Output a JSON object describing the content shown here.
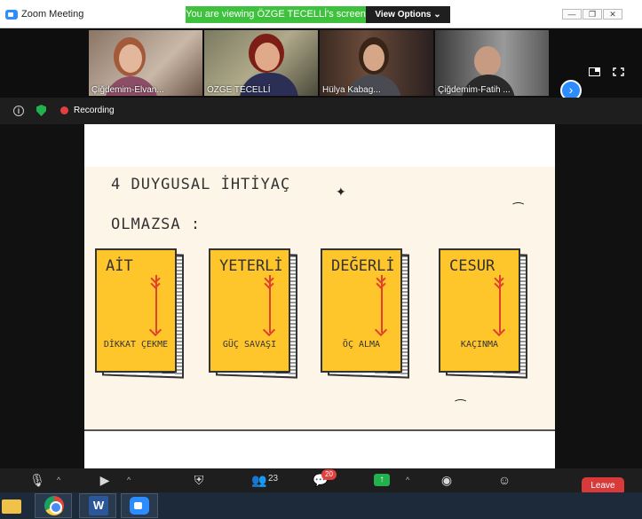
{
  "window": {
    "title": "Zoom Meeting"
  },
  "share_banner": {
    "text": "You are viewing ÖZGE TECELLİ's screen",
    "view_options": "View Options ⌄"
  },
  "window_controls": {
    "minimize": "—",
    "restore": "❐",
    "close": "✕"
  },
  "participants": [
    {
      "name": "Çiğdemim-Elvan..."
    },
    {
      "name": "ÖZGE TECELLİ"
    },
    {
      "name": "Hülya Kabag..."
    },
    {
      "name": "Çiğdemim-Fatih ..."
    }
  ],
  "status": {
    "recording": "Recording"
  },
  "slide": {
    "title_line1": "4 DUYGUSAL İHTİYAÇ",
    "title_line2": "OLMAZSA :",
    "cards": [
      {
        "need": "AİT",
        "result": "DİKKAT ÇEKME"
      },
      {
        "need": "YETERLİ",
        "result": "GÜÇ SAVAŞI"
      },
      {
        "need": "DEĞERLİ",
        "result": "ÖÇ ALMA"
      },
      {
        "need": "CESUR",
        "result": "KAÇINMA"
      }
    ]
  },
  "toolbar": {
    "participants_count": "23",
    "chat_badge": "20",
    "leave": "Leave",
    "labels": {
      "mute": "Unmute",
      "video": "Start Video",
      "security": "Security",
      "participants": "Participants",
      "chat": "Chat",
      "share": "Share Screen",
      "record": "Record",
      "reactions": "Reactions"
    }
  },
  "colors": {
    "card_yellow": "#ffc62c",
    "arrow_red": "#e0402c",
    "zoom_blue": "#2d8cff",
    "banner_green": "#3ec23e",
    "leave_red": "#d83a3a"
  },
  "taskbar": {
    "word_label": "W"
  }
}
